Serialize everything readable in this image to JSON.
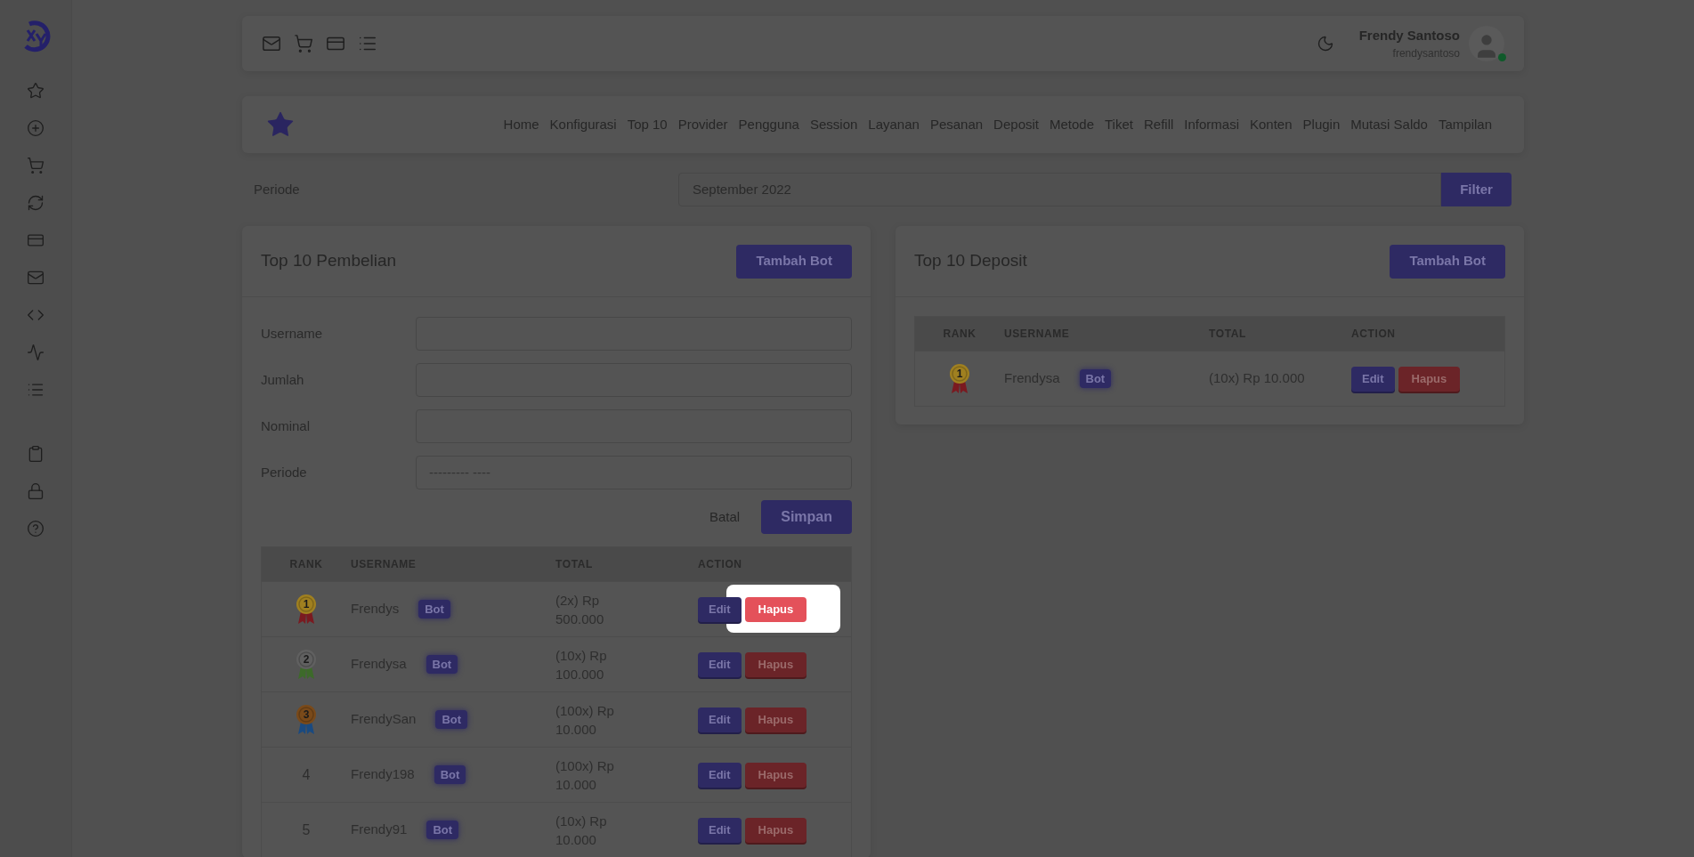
{
  "user": {
    "name": "Frendy Santoso",
    "handle": "frendysantoso",
    "online": true
  },
  "nav": {
    "items": [
      "Home",
      "Konfigurasi",
      "Top 10",
      "Provider",
      "Pengguna",
      "Session",
      "Layanan",
      "Pesanan",
      "Deposit",
      "Metode",
      "Tiket",
      "Refill",
      "Informasi",
      "Konten",
      "Plugin",
      "Mutasi Saldo",
      "Tampilan"
    ]
  },
  "filter": {
    "label": "Periode",
    "value": "September 2022",
    "button": "Filter"
  },
  "purchases": {
    "title": "Top 10 Pembelian",
    "add_button": "Tambah Bot",
    "form": [
      {
        "label": "Username",
        "kind": "text"
      },
      {
        "label": "Jumlah",
        "kind": "text"
      },
      {
        "label": "Nominal",
        "kind": "text"
      },
      {
        "label": "Periode",
        "kind": "month",
        "placeholder": "--------- ----"
      }
    ],
    "cancel": "Batal",
    "save": "Simpan",
    "columns": [
      "RANK",
      "USERNAME",
      "TOTAL",
      "ACTION"
    ],
    "rows": [
      {
        "rank": "1",
        "kind": "medal",
        "color": "#a08020",
        "username": "Frendys",
        "tag": "Bot",
        "total": "(2x) Rp 500.000",
        "edit": "Edit",
        "delete": "Hapus",
        "highlighted": true
      },
      {
        "rank": "2",
        "kind": "medal",
        "color": "#606060",
        "username": "Frendysa",
        "tag": "Bot",
        "total": "(10x) Rp 100.000",
        "edit": "Edit",
        "delete": "Hapus",
        "highlighted": false
      },
      {
        "rank": "3",
        "kind": "medal",
        "color": "#7a4a1a",
        "username": "FrendySan",
        "tag": "Bot",
        "total": "(100x) Rp 10.000",
        "edit": "Edit",
        "delete": "Hapus",
        "highlighted": false
      },
      {
        "rank": "4",
        "kind": "number",
        "username": "Frendy198",
        "tag": "Bot",
        "total": "(100x) Rp 10.000",
        "edit": "Edit",
        "delete": "Hapus",
        "highlighted": false
      },
      {
        "rank": "5",
        "kind": "number",
        "username": "Frendy91",
        "tag": "Bot",
        "total": "(10x) Rp 10.000",
        "edit": "Edit",
        "delete": "Hapus",
        "highlighted": false
      }
    ]
  },
  "deposits": {
    "title": "Top 10 Deposit",
    "add_button": "Tambah Bot",
    "columns": [
      "RANK",
      "USERNAME",
      "TOTAL",
      "ACTION"
    ],
    "rows": [
      {
        "rank": "1",
        "kind": "medal",
        "color": "#a08020",
        "username": "Frendysa",
        "tag": "Bot",
        "total": "(10x) Rp 10.000",
        "edit": "Edit",
        "delete": "Hapus",
        "highlighted": false
      }
    ]
  }
}
